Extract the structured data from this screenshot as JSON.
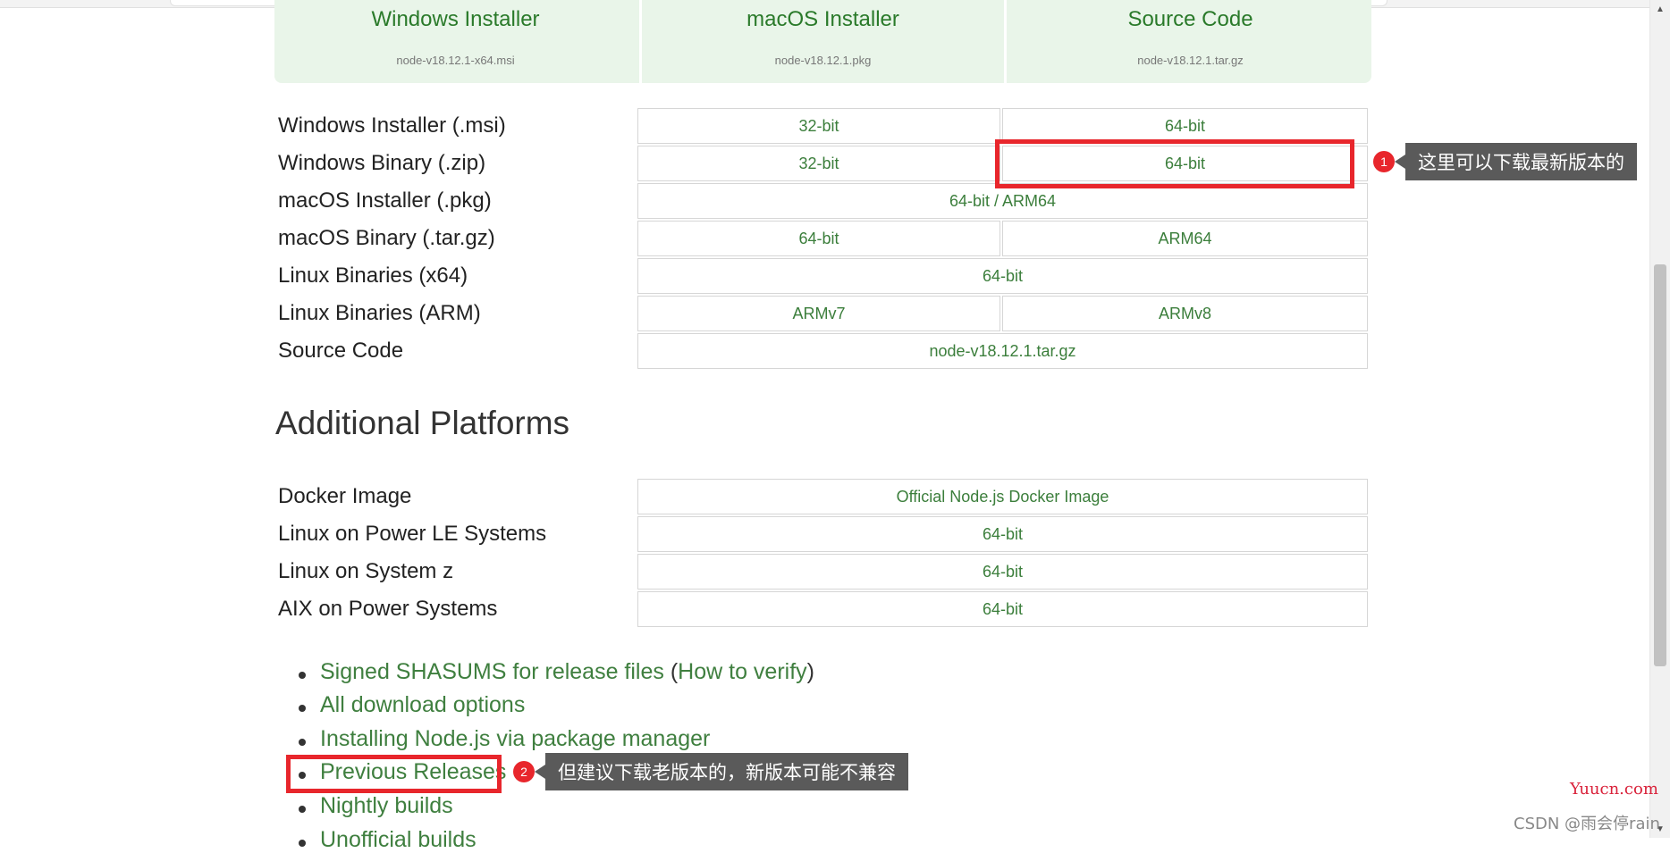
{
  "hero": [
    {
      "title": "Windows Installer",
      "file": "node-v18.12.1-x64.msi"
    },
    {
      "title": "macOS Installer",
      "file": "node-v18.12.1.pkg"
    },
    {
      "title": "Source Code",
      "file": "node-v18.12.1.tar.gz"
    }
  ],
  "downloads": [
    {
      "label": "Windows Installer (.msi)",
      "cells": [
        "32-bit",
        "64-bit"
      ]
    },
    {
      "label": "Windows Binary (.zip)",
      "cells": [
        "32-bit",
        "64-bit"
      ]
    },
    {
      "label": "macOS Installer (.pkg)",
      "cells": [
        "64-bit / ARM64"
      ]
    },
    {
      "label": "macOS Binary (.tar.gz)",
      "cells": [
        "64-bit",
        "ARM64"
      ]
    },
    {
      "label": "Linux Binaries (x64)",
      "cells": [
        "64-bit"
      ]
    },
    {
      "label": "Linux Binaries (ARM)",
      "cells": [
        "ARMv7",
        "ARMv8"
      ]
    },
    {
      "label": "Source Code",
      "cells": [
        "node-v18.12.1.tar.gz"
      ]
    }
  ],
  "additional": {
    "title": "Additional Platforms",
    "rows": [
      {
        "label": "Docker Image",
        "cells": [
          "Official Node.js Docker Image"
        ]
      },
      {
        "label": "Linux on Power LE Systems",
        "cells": [
          "64-bit"
        ]
      },
      {
        "label": "Linux on System z",
        "cells": [
          "64-bit"
        ]
      },
      {
        "label": "AIX on Power Systems",
        "cells": [
          "64-bit"
        ]
      }
    ]
  },
  "links": {
    "shasums": "Signed SHASUMS for release files",
    "verify_open": "(",
    "verify": "How to verify",
    "verify_close": ")",
    "all_options": "All download options",
    "package_manager": "Installing Node.js via package manager",
    "previous": "Previous Releases",
    "nightly": "Nightly builds",
    "unofficial": "Unofficial builds"
  },
  "annotations": [
    {
      "number": "1",
      "text": "这里可以下载最新版本的"
    },
    {
      "number": "2",
      "text": "但建议下载老版本的，新版本可能不兼容"
    }
  ],
  "watermarks": {
    "site": "Yuucn.com",
    "author": "CSDN @雨会停rain"
  },
  "colors": {
    "link_green": "#3f7f3f",
    "hero_bg": "#e9f5e9",
    "annotation_red": "#e8262c"
  }
}
